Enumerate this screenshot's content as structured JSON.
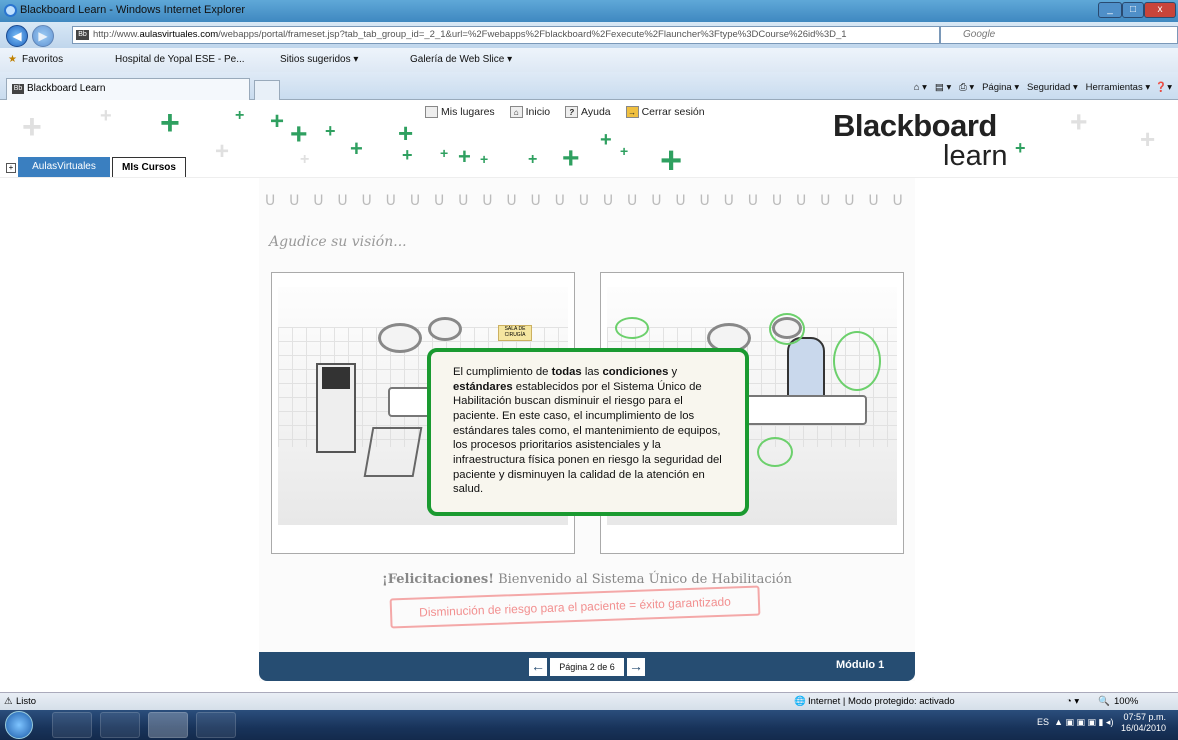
{
  "window": {
    "title": "Blackboard Learn - Windows Internet Explorer"
  },
  "address": {
    "url_prefix": "http://www.",
    "url_domain": "aulasvirtuales.com",
    "url_rest": "/webapps/portal/frameset.jsp?tab_tab_group_id=_2_1&url=%2Fwebapps%2Fblackboard%2Fexecute%2Flauncher%3Ftype%3DCourse%26id%3D_1",
    "search_placeholder": "Google"
  },
  "favorites": {
    "label": "Favoritos",
    "items": [
      "Hospital de Yopal ESE - Pe...",
      "Sitios sugeridos ▾",
      "Galería de Web Slice ▾"
    ]
  },
  "tabs": {
    "active": "Blackboard Learn"
  },
  "commandbar": {
    "items": [
      "Página ▾",
      "Seguridad ▾",
      "Herramientas ▾"
    ]
  },
  "bb": {
    "links": [
      "Mis lugares",
      "Inicio",
      "Ayuda",
      "Cerrar sesión"
    ],
    "logo_top": "Blackboard",
    "logo_bottom": "learn",
    "tab_aulas": "AulasVirtuales",
    "tab_cursos": "MIs Cursos"
  },
  "module": {
    "heading": "Agudice su visión...",
    "popup_parts": {
      "p1": "El cumplimiento de ",
      "b1": "todas",
      "p2": " las ",
      "b2": "condiciones",
      "p3": " y ",
      "b3": "estándares",
      "p4": " establecidos por el Sistema Único de Habilitación buscan disminuir el riesgo para el paciente. En este caso, el incumplimiento de los estándares tales como, el mantenimiento de equipos, los procesos prioritarios asistenciales y la infraestructura física ponen en riesgo la seguridad del paciente y disminuyen la calidad de la atención en salud."
    },
    "footer_bold": "¡Felicitaciones!",
    "footer_rest": " Bienvenido al Sistema Único de Habilitación",
    "stamp": "Disminución de riesgo para el paciente = éxito garantizado",
    "page_label": "Página 2 de 6",
    "module_label": "Módulo 1",
    "sign_text": "SALA DE CIRUGÍA"
  },
  "status": {
    "left": "Listo",
    "zone": "Internet | Modo protegido: activado",
    "zoom": "100%"
  },
  "taskbar": {
    "lang": "ES",
    "time": "07:57 p.m.",
    "date": "16/04/2010"
  },
  "colors": {
    "accent_green": "#1a9a30",
    "nav_blue": "#264d72",
    "tab_blue": "#3a7fc0"
  }
}
